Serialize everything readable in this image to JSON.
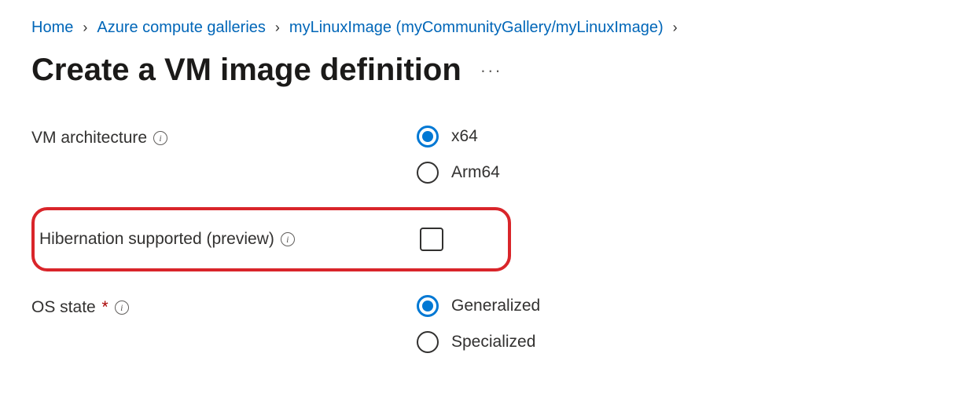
{
  "breadcrumb": {
    "home": "Home",
    "galleries": "Azure compute galleries",
    "current": "myLinuxImage (myCommunityGallery/myLinuxImage)"
  },
  "pageTitle": "Create a VM image definition",
  "moreLabel": "···",
  "form": {
    "architecture": {
      "label": "VM architecture",
      "options": {
        "x64": "x64",
        "arm64": "Arm64"
      }
    },
    "hibernation": {
      "label": "Hibernation supported (preview)"
    },
    "osState": {
      "label": "OS state",
      "required": "*",
      "options": {
        "generalized": "Generalized",
        "specialized": "Specialized"
      }
    }
  }
}
